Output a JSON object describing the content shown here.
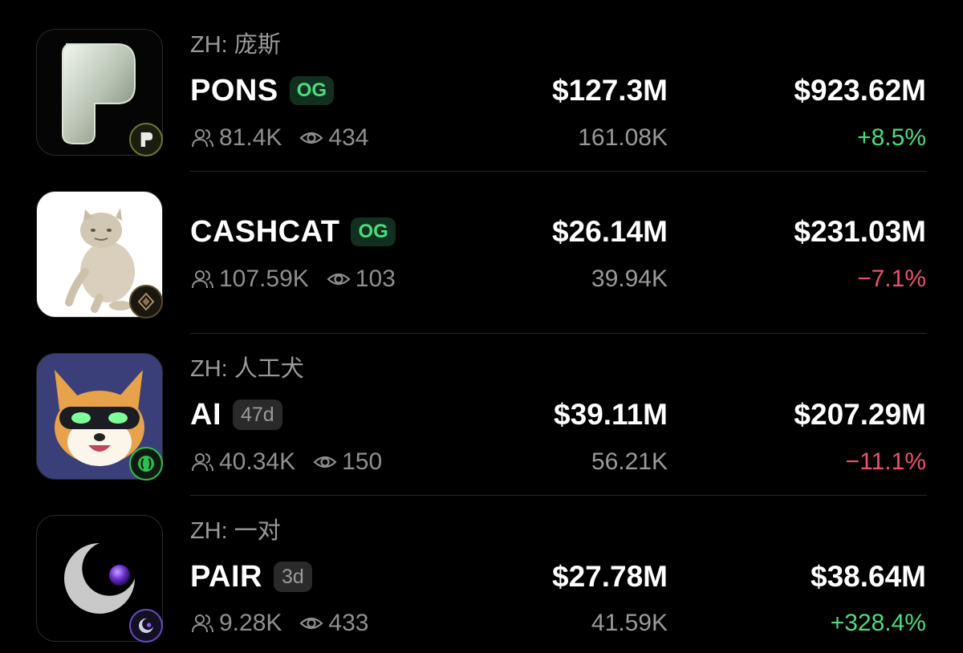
{
  "rows": [
    {
      "zh_label": "ZH: 庞斯",
      "ticker": "PONS",
      "badge": "OG",
      "holders": "81.4K",
      "views": "434",
      "market_cap": "$127.3M",
      "volume": "161.08K",
      "price_value": "$923.62M",
      "change": "+8.5%"
    },
    {
      "ticker": "CASHCAT",
      "badge": "OG",
      "holders": "107.59K",
      "views": "103",
      "market_cap": "$26.14M",
      "volume": "39.94K",
      "price_value": "$231.03M",
      "change": "−7.1%"
    },
    {
      "zh_label": "ZH: 人工犬",
      "ticker": "AI",
      "badge": "47d",
      "holders": "40.34K",
      "views": "150",
      "market_cap": "$39.11M",
      "volume": "56.21K",
      "price_value": "$207.29M",
      "change": "−11.1%"
    },
    {
      "zh_label": "ZH: 一对",
      "ticker": "PAIR",
      "badge": "3d",
      "holders": "9.28K",
      "views": "433",
      "market_cap": "$27.78M",
      "volume": "41.59K",
      "price_value": "$38.64M",
      "change": "+328.4%"
    }
  ],
  "colors": {
    "positive": "#4ade80",
    "negative": "#f0506e",
    "og_badge_bg": "#12301f",
    "background": "#000000"
  },
  "icons": [
    "users-icon",
    "eye-icon"
  ]
}
